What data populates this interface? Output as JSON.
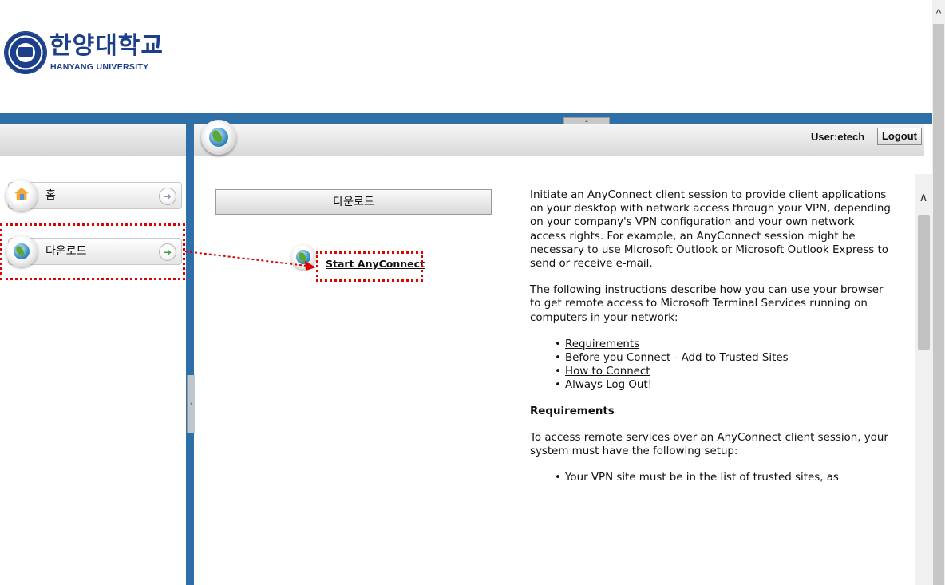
{
  "header": {
    "logo_korean": "한양대학교",
    "logo_english": "HANYANG UNIVERSITY"
  },
  "topbar": {
    "user_label": "User:etech",
    "logout_label": "Logout"
  },
  "sidebar": {
    "items": [
      {
        "label": "홈",
        "icon": "home-icon",
        "active": false
      },
      {
        "label": "다운로드",
        "icon": "globe-icon",
        "active": true
      }
    ]
  },
  "center": {
    "section_title": "다운로드",
    "start_link": "Start AnyConnect"
  },
  "content": {
    "intro": "Initiate an AnyConnect client session to provide client applications on your desktop with network access through your VPN, depending on your company's VPN configuration and your own network access rights. For example, an AnyConnect session might be necessary to use Microsoft Outlook or Microsoft Outlook Express to send or receive e-mail.",
    "instructions": "The following instructions describe how you can use your browser to get remote access to Microsoft Terminal Services running on computers in your network:",
    "links": [
      "Requirements",
      "Before you Connect - Add to Trusted Sites",
      "How to Connect",
      "Always Log Out!"
    ],
    "requirements_heading": "Requirements",
    "requirements_text": "To access remote services over an AnyConnect client session, your system must have the following setup:",
    "requirements_items": [
      "Your VPN site must be in the list of trusted sites, as"
    ]
  },
  "colors": {
    "brand_blue": "#1c3f8c",
    "band_blue": "#2f6fa8",
    "highlight_red": "#e00000"
  }
}
